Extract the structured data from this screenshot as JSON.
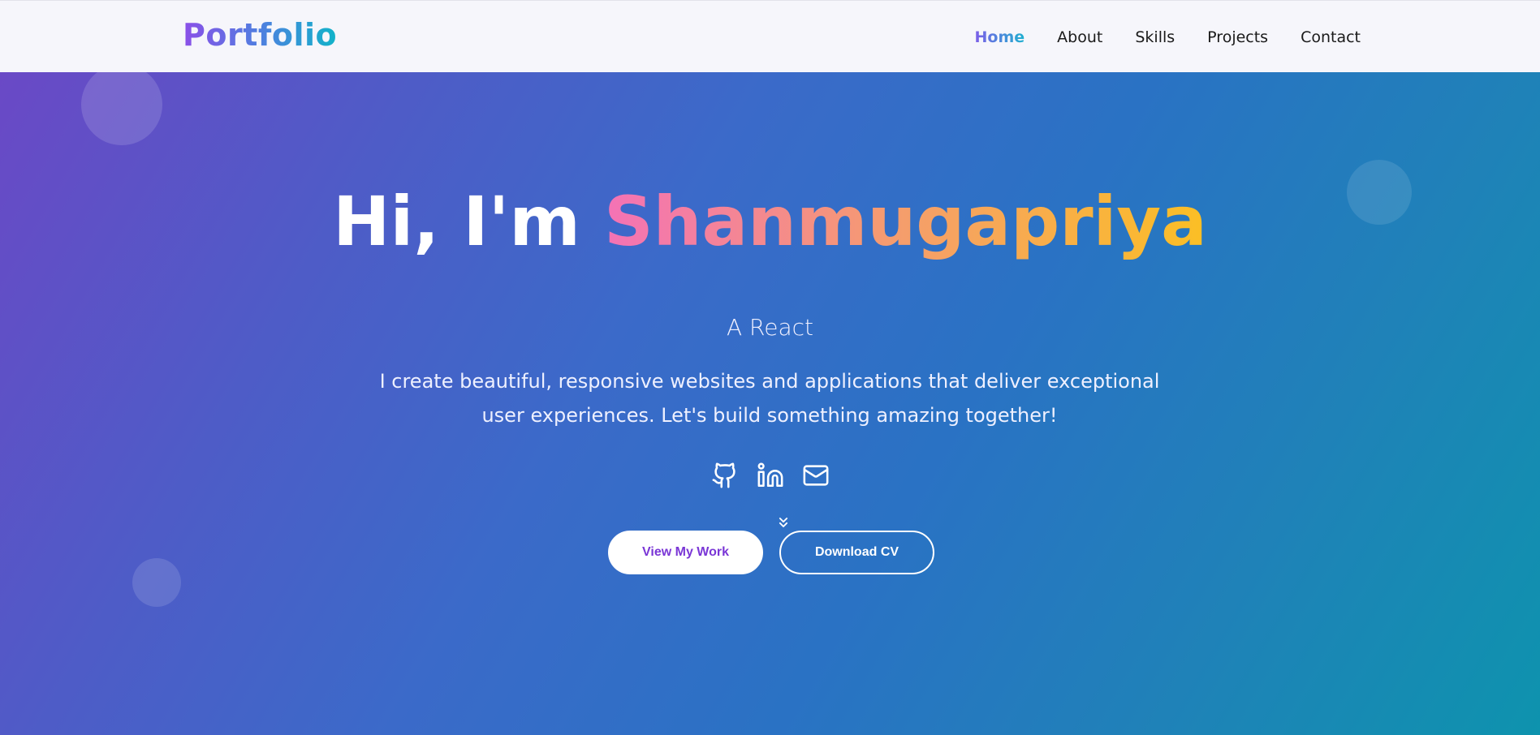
{
  "nav": {
    "logo": "Portfolio",
    "links": [
      {
        "label": "Home",
        "active": true
      },
      {
        "label": "About",
        "active": false
      },
      {
        "label": "Skills",
        "active": false
      },
      {
        "label": "Projects",
        "active": false
      },
      {
        "label": "Contact",
        "active": false
      }
    ]
  },
  "hero": {
    "greeting": "Hi, I'm ",
    "name": "Shanmugapriya",
    "subtitle": "A React",
    "description": "I create beautiful, responsive websites and applications that deliver exceptional user experiences. Let's build something amazing together!",
    "socials": [
      {
        "icon": "github-icon"
      },
      {
        "icon": "linkedin-icon"
      },
      {
        "icon": "mail-icon"
      }
    ],
    "scroll_icon": "chevrons-down-icon",
    "primary_button": "View My Work",
    "secondary_button": "Download CV"
  },
  "colors": {
    "accent_purple": "#7a36d6",
    "accent_teal": "#11b3c9",
    "name_gradient_start": "#f472b6",
    "name_gradient_end": "#fbbf24"
  }
}
